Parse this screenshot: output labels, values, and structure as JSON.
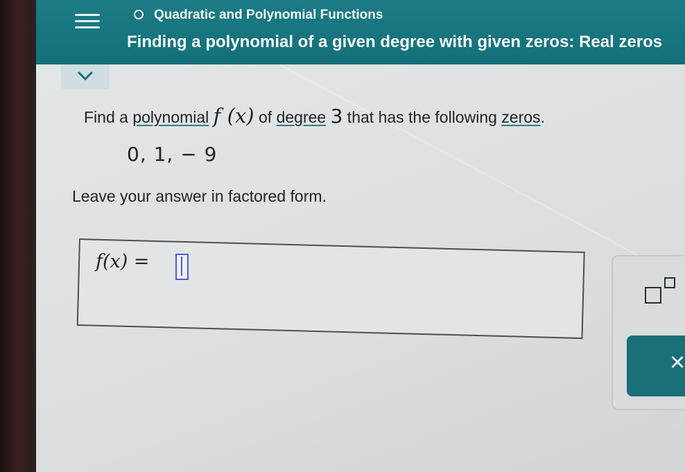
{
  "header": {
    "topic": "Quadratic and Polynomial Functions",
    "subtitle": "Finding a polynomial of a given degree with given zeros: Real zeros"
  },
  "question": {
    "part1": "Find a ",
    "term_polynomial": "polynomial",
    "function_name": "f (x)",
    "part2": " of ",
    "term_degree": "degree",
    "degree_value": "3",
    "part3": " that has the following ",
    "term_zeros": "zeros",
    "end": "."
  },
  "zeros_list": "0,  1,  − 9",
  "instruction": "Leave your answer in factored form.",
  "answer": {
    "label": "f(x) =",
    "value": ""
  },
  "tools": {
    "clear_label": "×"
  },
  "colors": {
    "header_bg": "#13707a",
    "accent": "#2e7d86",
    "cursor": "#4f5bd6"
  }
}
